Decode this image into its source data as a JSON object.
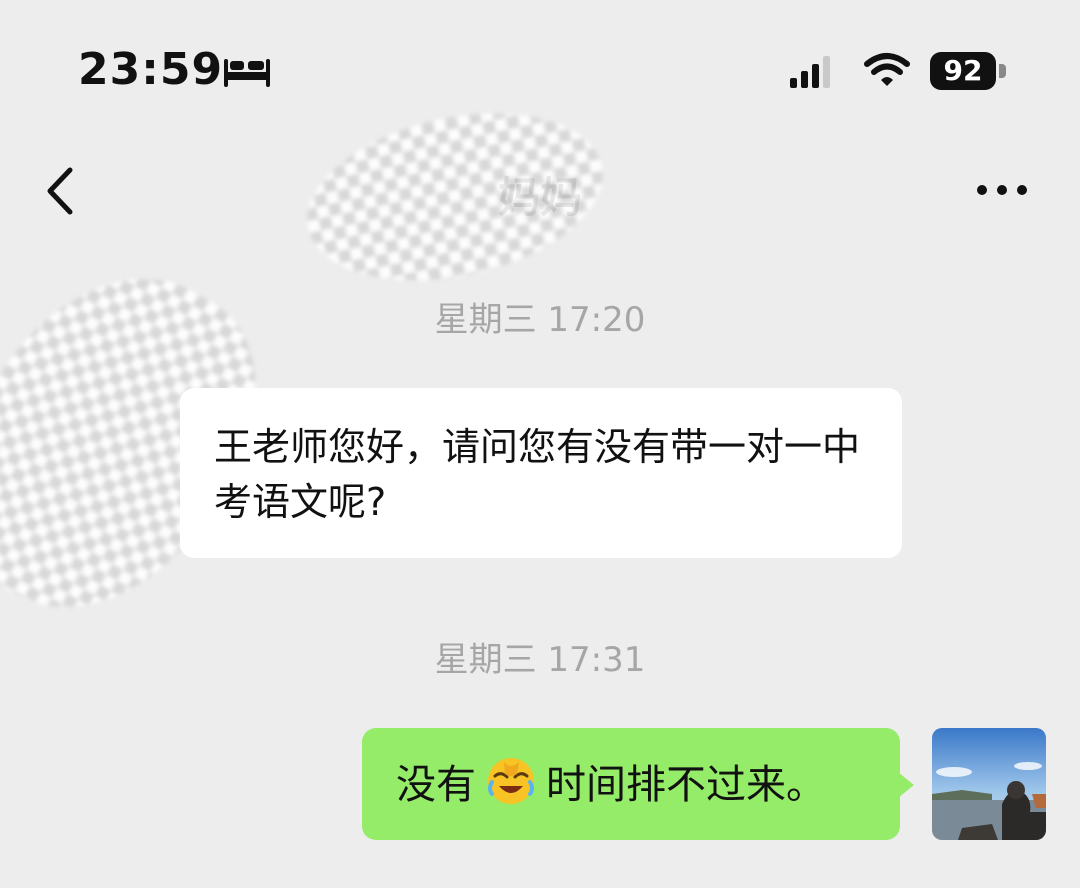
{
  "status_bar": {
    "time": "23:59",
    "sleep_icon": "bed-icon",
    "signal_icon": "cellular-signal-icon",
    "wifi_icon": "wifi-icon",
    "battery_level": "92"
  },
  "nav": {
    "back_icon": "chevron-left-icon",
    "title": "妈妈",
    "more_icon": "ellipsis-icon"
  },
  "messages": [
    {
      "timestamp": "星期三 17:20",
      "sender": "other",
      "text": "王老师您好，请问您有没有带一对一中考语文呢?"
    },
    {
      "timestamp": "星期三 17:31",
      "sender": "self",
      "text_before": "没有",
      "emoji": "face-palm-laughing-emoji",
      "text_after": "时间排不过来。"
    }
  ],
  "colors": {
    "background": "#ededed",
    "incoming_bubble": "#ffffff",
    "outgoing_bubble": "#95ec69",
    "timestamp": "#a6a6a6"
  }
}
